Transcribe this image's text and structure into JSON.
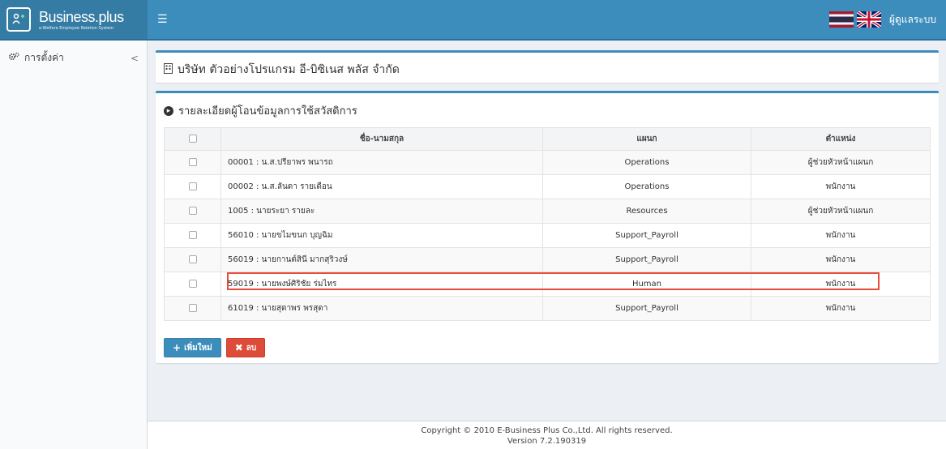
{
  "header": {
    "brand_main": "Business",
    "brand_suffix": ".plus",
    "brand_tagline": "e-Welfare Employee Relation System",
    "menu_icon": "hamburger-icon",
    "user_label": "ผู้ดูแลระบบ",
    "accent_color": "#3c8dbc"
  },
  "sidebar": {
    "items": [
      {
        "icon": "gears-icon",
        "label": "การตั้งค่า",
        "chevron": "<"
      }
    ]
  },
  "company": {
    "name": "บริษัท ตัวอย่างโปรแกรม อี-บิซิเนส พลัส จำกัด"
  },
  "panel": {
    "title": "รายละเอียดผู้โอนข้อมูลการใช้สวัสดิการ",
    "columns": [
      "ชื่อ-นามสกุล",
      "แผนก",
      "ตำแหน่ง"
    ],
    "rows": [
      {
        "name": "00001 : น.ส.ปรียาพร พนารถ",
        "dept": "Operations",
        "position": "ผู้ช่วยหัวหน้าแผนก"
      },
      {
        "name": "00002 : น.ส.ลันดา รายเดือน",
        "dept": "Operations",
        "position": "พนักงาน"
      },
      {
        "name": "1005 : นายระยา รายละ",
        "dept": "Resources",
        "position": "ผู้ช่วยหัวหน้าแผนก"
      },
      {
        "name": "56010 : นายขไมขนก บุญฉิม",
        "dept": "Support_Payroll",
        "position": "พนักงาน"
      },
      {
        "name": "56019 : นายกานต์สินี มากสุริวงษ์",
        "dept": "Support_Payroll",
        "position": "พนักงาน"
      },
      {
        "name": "59019 : นายพงษ์ศิริชัย ร่มไทร",
        "dept": "Human",
        "position": "พนักงาน"
      },
      {
        "name": "61019 : นายสุดาพร พรสุดา",
        "dept": "Support_Payroll",
        "position": "พนักงาน"
      }
    ],
    "add_button": "เพิ่มใหม่",
    "delete_button": "ลบ"
  },
  "footer": {
    "copyright": "Copyright © 2010 E-Business Plus Co.,Ltd. All rights reserved.",
    "version": "Version 7.2.190319"
  }
}
